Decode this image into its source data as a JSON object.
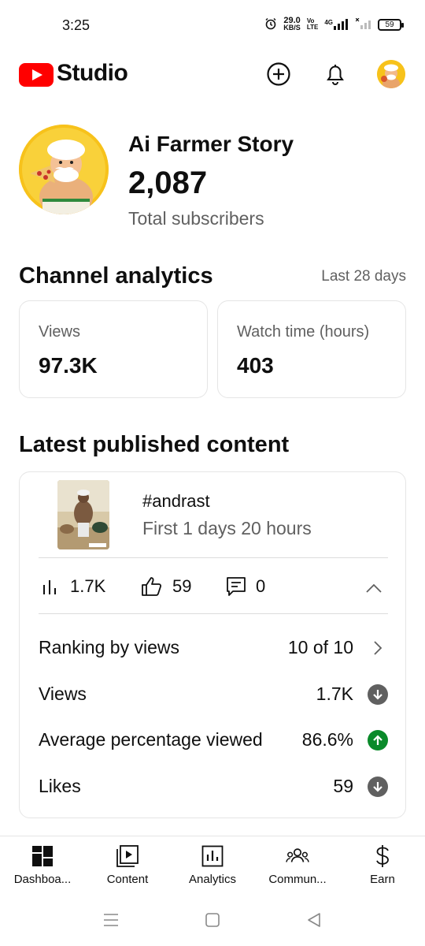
{
  "status_bar": {
    "time": "3:25",
    "net_speed_value": "29.0",
    "net_speed_unit": "KB/S",
    "volte_top": "Vo",
    "volte_bottom": "LTE",
    "network": "4G",
    "battery": "59"
  },
  "header": {
    "app_name": "Studio",
    "icons": [
      "youtube-logo-icon",
      "create-plus-icon",
      "bell-icon",
      "account-avatar"
    ]
  },
  "channel": {
    "name": "Ai Farmer Story",
    "subscribers": "2,087",
    "subscribers_label": "Total subscribers"
  },
  "analytics": {
    "title": "Channel analytics",
    "period": "Last 28 days",
    "metrics": [
      {
        "label": "Views",
        "value": "97.3K"
      },
      {
        "label": "Watch time (hours)",
        "value": "403"
      }
    ]
  },
  "latest": {
    "title": "Latest published content",
    "video_title": "#andrast",
    "video_age": "First 1 days 20 hours",
    "stats": {
      "views": "1.7K",
      "likes": "59",
      "comments": "0"
    },
    "rows": [
      {
        "label": "Ranking by views",
        "value": "10 of 10",
        "icon": "chevron-right-icon"
      },
      {
        "label": "Views",
        "value": "1.7K",
        "icon": "arrow-down-icon"
      },
      {
        "label": "Average percentage viewed",
        "value": "86.6%",
        "icon": "arrow-up-icon"
      },
      {
        "label": "Likes",
        "value": "59",
        "icon": "arrow-down-icon"
      }
    ]
  },
  "colors": {
    "brand_red": "#ff0000",
    "positive_green": "#0a8a2a",
    "neutral_grey": "#606060"
  },
  "bottom_nav": [
    {
      "label": "Dashboa...",
      "icon": "dashboard-icon"
    },
    {
      "label": "Content",
      "icon": "content-icon"
    },
    {
      "label": "Analytics",
      "icon": "analytics-icon"
    },
    {
      "label": "Commun...",
      "icon": "community-icon"
    },
    {
      "label": "Earn",
      "icon": "dollar-icon"
    }
  ]
}
